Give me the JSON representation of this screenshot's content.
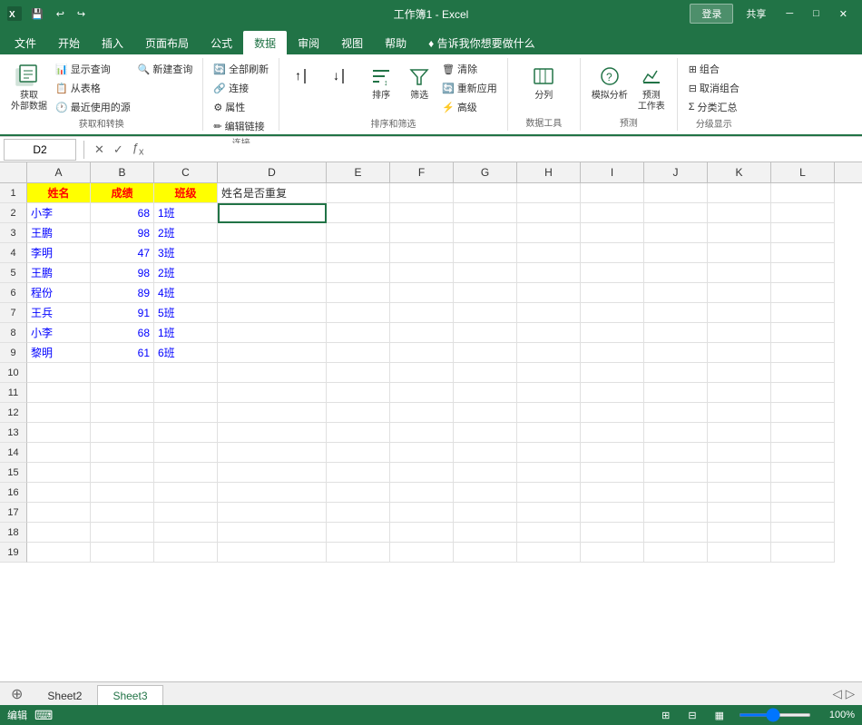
{
  "titlebar": {
    "title": "工作簿1 - Excel",
    "login_btn": "登录",
    "share_btn": "共享",
    "qat": [
      "save",
      "undo",
      "redo"
    ],
    "win_btns": [
      "minimize",
      "restore",
      "close"
    ]
  },
  "ribbon": {
    "tabs": [
      "文件",
      "开始",
      "插入",
      "页面布局",
      "公式",
      "数据",
      "审阅",
      "视图",
      "帮助",
      "告诉我你想要做什么"
    ],
    "active_tab": "数据",
    "groups": [
      {
        "label": "获取和转换",
        "items_large": [
          {
            "label": "获取\n外部数据",
            "icon": "database"
          }
        ],
        "items_small_cols": [
          [
            "显示查询",
            "从表格",
            "最近使用的源"
          ],
          [
            "新建\n查询"
          ]
        ]
      },
      {
        "label": "连接",
        "items": [
          "连接",
          "属性",
          "编辑链接",
          "全部刷新"
        ]
      },
      {
        "label": "排序和筛选",
        "items": [
          "排序",
          "筛选",
          "清除",
          "重新应用",
          "高级"
        ]
      },
      {
        "label": "数据工具",
        "items": [
          "分列"
        ]
      },
      {
        "label": "预测",
        "items": [
          "模拟分析",
          "预测\n工作表"
        ]
      },
      {
        "label": "分级显示",
        "items": [
          "组合",
          "取消组合",
          "分类汇总"
        ]
      }
    ]
  },
  "formula_bar": {
    "name_box": "D2",
    "formula": ""
  },
  "columns": [
    "A",
    "B",
    "C",
    "D",
    "E",
    "F",
    "G",
    "H",
    "I",
    "J",
    "K",
    "L"
  ],
  "rows": [
    1,
    2,
    3,
    4,
    5,
    6,
    7,
    8,
    9,
    10,
    11,
    12,
    13,
    14,
    15,
    16,
    17,
    18,
    19
  ],
  "cells": {
    "A1": {
      "value": "姓名",
      "style": "header"
    },
    "B1": {
      "value": "成绩",
      "style": "header"
    },
    "C1": {
      "value": "班级",
      "style": "header"
    },
    "D1": {
      "value": "姓名是否重复",
      "style": "normal"
    },
    "A2": {
      "value": "小李",
      "style": "data-name"
    },
    "B2": {
      "value": "68",
      "style": "data-score"
    },
    "C2": {
      "value": "1班",
      "style": "data-class"
    },
    "A3": {
      "value": "王鹏",
      "style": "data-name"
    },
    "B3": {
      "value": "98",
      "style": "data-score"
    },
    "C3": {
      "value": "2班",
      "style": "data-class"
    },
    "A4": {
      "value": "李明",
      "style": "data-name"
    },
    "B4": {
      "value": "47",
      "style": "data-score"
    },
    "C4": {
      "value": "3班",
      "style": "data-class"
    },
    "A5": {
      "value": "王鹏",
      "style": "data-name"
    },
    "B5": {
      "value": "98",
      "style": "data-score"
    },
    "C5": {
      "value": "2班",
      "style": "data-class"
    },
    "A6": {
      "value": "程份",
      "style": "data-name"
    },
    "B6": {
      "value": "89",
      "style": "data-score"
    },
    "C6": {
      "value": "4班",
      "style": "data-class"
    },
    "A7": {
      "value": "王兵",
      "style": "data-name"
    },
    "B7": {
      "value": "91",
      "style": "data-score"
    },
    "C7": {
      "value": "5班",
      "style": "data-class"
    },
    "A8": {
      "value": "小李",
      "style": "data-name"
    },
    "B8": {
      "value": "68",
      "style": "data-score"
    },
    "C8": {
      "value": "1班",
      "style": "data-class"
    },
    "A9": {
      "value": "黎明",
      "style": "data-name"
    },
    "B9": {
      "value": "61",
      "style": "data-score"
    },
    "C9": {
      "value": "6班",
      "style": "data-class"
    }
  },
  "selected_cell": "D2",
  "sheet_tabs": [
    "Sheet2",
    "Sheet3"
  ],
  "active_sheet": "Sheet3",
  "status": {
    "mode": "编辑",
    "zoom": "100%"
  }
}
